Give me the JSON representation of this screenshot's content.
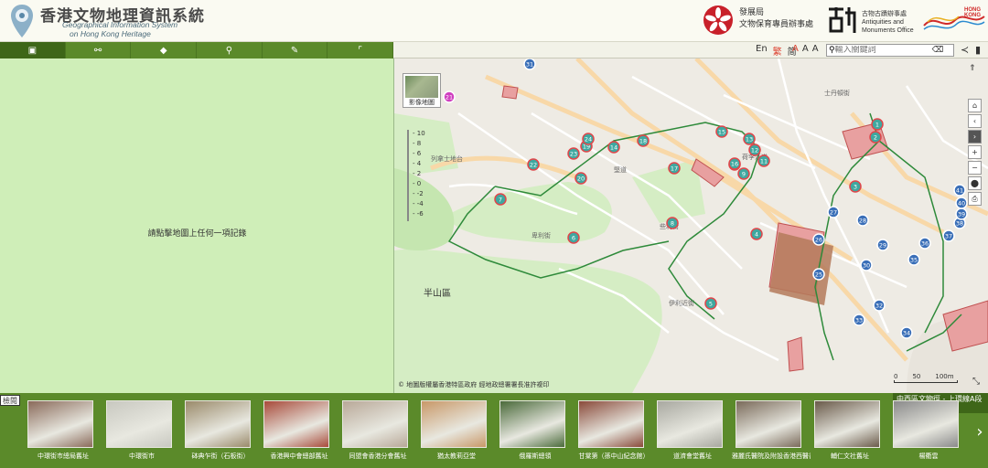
{
  "header": {
    "title_zh": "香港文物地理資訊系統",
    "title_en_1": "Geographical Information System",
    "title_en_2": "on Hong Kong Heritage",
    "devb_name": [
      "發展局",
      "文物保育專員辦事處"
    ],
    "amo_name_zh": "古物古蹟辦事處",
    "amo_name_en": [
      "Antiquities and",
      "Monuments Office"
    ]
  },
  "toolbar": {
    "tabs": [
      {
        "name": "tab-imagery",
        "icon": "image-icon",
        "glyph": "▣"
      },
      {
        "name": "tab-route",
        "icon": "route-icon",
        "glyph": "⚯"
      },
      {
        "name": "tab-layers",
        "icon": "layers-icon",
        "glyph": "◆"
      },
      {
        "name": "tab-search",
        "icon": "search-icon",
        "glyph": "⚲"
      },
      {
        "name": "tab-draw",
        "icon": "pencil-icon",
        "glyph": "✎"
      },
      {
        "name": "tab-measure",
        "icon": "measure-icon",
        "glyph": "⌜"
      }
    ],
    "langs": [
      "En",
      "繁",
      "简"
    ],
    "font_sizes": [
      "A",
      "A",
      "A"
    ],
    "search_placeholder": "輸入關鍵詞"
  },
  "left_panel": {
    "hint": "請點擊地圖上任何一項記錄"
  },
  "map": {
    "imagery_button": "影像地圖",
    "zoom_ticks": [
      "10",
      "8",
      "6",
      "4",
      "2",
      "0",
      "-2",
      "-4",
      "-6"
    ],
    "district": "半山區",
    "attribution": "© 地圖版權屬香港特區政府 經地政總署署長准許複印",
    "scale_labels": [
      "0",
      "50",
      "100m"
    ],
    "street_labels": [
      "列拿士地台",
      "堅道",
      "卑利街",
      "些利街",
      "荷李活道",
      "士丹頓街",
      "伊利近街"
    ],
    "controls": [
      {
        "name": "home-button",
        "glyph": "⌂"
      },
      {
        "name": "pan-left-button",
        "glyph": "‹"
      },
      {
        "name": "pan-right-button",
        "glyph": "›"
      },
      {
        "name": "zoom-in-button",
        "glyph": "+"
      },
      {
        "name": "zoom-out-button",
        "glyph": "−"
      },
      {
        "name": "locate-button",
        "glyph": "⬤"
      },
      {
        "name": "print-button",
        "glyph": "⎙"
      }
    ],
    "markers_red": [
      "1",
      "2",
      "3",
      "4",
      "5",
      "6",
      "7",
      "8",
      "9",
      "10",
      "11",
      "12",
      "13",
      "14",
      "15",
      "16",
      "17",
      "18",
      "19",
      "20",
      "22",
      "23",
      "24"
    ],
    "markers_blue": [
      "25",
      "26",
      "27",
      "28",
      "29",
      "30",
      "31",
      "32",
      "33",
      "34",
      "35",
      "36",
      "37",
      "38",
      "39",
      "40",
      "41"
    ],
    "markers_purple": [
      "21"
    ]
  },
  "bottom": {
    "explore_label": "檢閱",
    "route_label": "中西區文物徑 - 上環線A段",
    "items": [
      {
        "caption": "中環街市總局舊址",
        "color": "#8a6a5a"
      },
      {
        "caption": "中環街市",
        "color": "#c8c8c0"
      },
      {
        "caption": "砵典乍街（石板街）",
        "color": "#9a8a6a"
      },
      {
        "caption": "香港興中會總部舊址",
        "color": "#a84a3a"
      },
      {
        "caption": "同盟會香港分會舊址",
        "color": "#b8a898"
      },
      {
        "caption": "猶太教莉亞堂",
        "color": "#c89868"
      },
      {
        "caption": "俄羅斯總領",
        "color": "#4a6a3a"
      },
      {
        "caption": "甘棠第（孫中山紀念館）",
        "color": "#8a4a3a"
      },
      {
        "caption": "道濟會堂舊址",
        "color": "#a8a8a0"
      },
      {
        "caption": "雅麗氏醫院及附設香港西醫書院舊址",
        "color": "#7a6a5a"
      },
      {
        "caption": "輔仁文社舊址",
        "color": "#6a5a4a"
      },
      {
        "caption": "楊衢雲",
        "color": "#8a8a8a"
      }
    ]
  },
  "colors": {
    "green_dark": "#5b8a2a",
    "green_panel": "#cfeeb8",
    "marker_red": "#e0464a",
    "marker_blue": "#3a6fb8",
    "marker_teal": "#3fa8a0"
  }
}
